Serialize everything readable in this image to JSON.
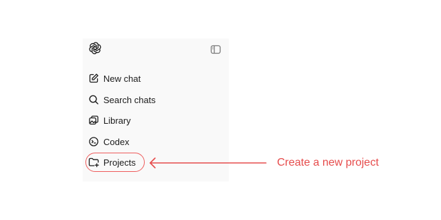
{
  "sidebar": {
    "logo_icon": "openai-logo-icon",
    "toggle_icon": "sidebar-toggle-icon",
    "items": [
      {
        "label": "New chat",
        "icon": "edit-icon"
      },
      {
        "label": "Search chats",
        "icon": "search-icon"
      },
      {
        "label": "Library",
        "icon": "library-icon"
      },
      {
        "label": "Codex",
        "icon": "codex-icon"
      },
      {
        "label": "Projects",
        "icon": "folder-plus-icon"
      }
    ]
  },
  "annotation": {
    "text": "Create a new project",
    "color": "#e64b4b",
    "highlight_target": "Projects"
  }
}
